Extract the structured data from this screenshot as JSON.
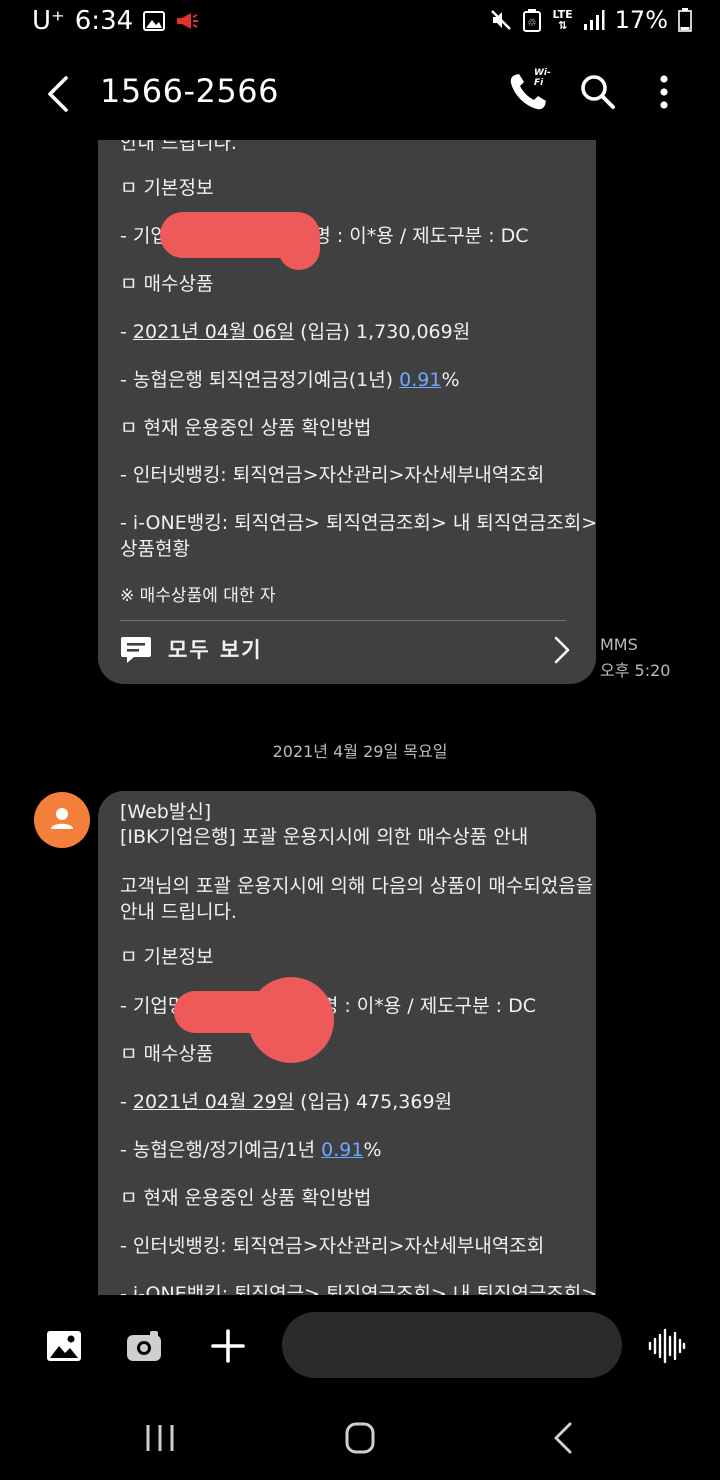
{
  "status_bar": {
    "carrier": "U⁺",
    "time": "6:34",
    "network": "LTE",
    "battery": "17%"
  },
  "header": {
    "title": "1566-2566",
    "call_badge": "Wi-Fi"
  },
  "message1": {
    "lines": [
      "안내 드립니다.",
      "ㅁ 기본정보",
      "- 기업",
      "자명 : 이*용 / 제도구분 : DC",
      "ㅁ 매수상품",
      "- ",
      "2021년 04월 06일",
      " (입금) 1,730,069원",
      "- 농협은행 퇴직연금정기예금(1년) ",
      "0.91",
      "%",
      "ㅁ 현재 운용중인 상품 확인방법",
      "- 인터넷뱅킹: 퇴직연금>자산관리>자산세부내역조회",
      "- i-ONE뱅킹: 퇴직연금> 퇴직연금조회> 내 퇴직연금조회>",
      "상품현황",
      "※ 매수상품에 대한 자"
    ],
    "see_all_label": "모두 보기",
    "type": "MMS",
    "time": "오후 5:20"
  },
  "date_separator": "2021년 4월 29일 목요일",
  "message2": {
    "lines": [
      "[Web발신]",
      "[IBK기업은행] 포괄 운용지시에 의한 매수상품 안내",
      "고객님의 포괄 운용지시에 의해 다음의 상품이 매수되었음을",
      "안내 드립니다.",
      "ㅁ 기본정보",
      "- 기업명",
      "자명 : 이*용 / 제도구분 : DC",
      "ㅁ 매수상품",
      "- ",
      "2021년 04월 29일",
      " (입금) 475,369원",
      "- 농협은행/정기예금/1년 ",
      "0.91",
      "%",
      "ㅁ 현재 운용중인 상품 확인방법",
      "- 인터넷뱅킹: 퇴직연금>자산관리>자산세부내역조회",
      "- i-ONE뱅킹: 퇴직연금> 퇴직연금조회> 내 퇴직연금조회>"
    ]
  },
  "icons": {
    "back": "arrow-left-icon",
    "call": "phone-icon",
    "search": "search-icon",
    "more": "more-vert-icon",
    "gallery": "image-icon",
    "camera": "camera-icon",
    "attach": "plus-icon",
    "voice": "voice-wave-icon"
  },
  "colors": {
    "bubble": "#404040",
    "link": "#6ea8ff",
    "avatar": "#f37f3a",
    "redaction": "#ee5a5a",
    "status_alert": "#e0322b"
  }
}
